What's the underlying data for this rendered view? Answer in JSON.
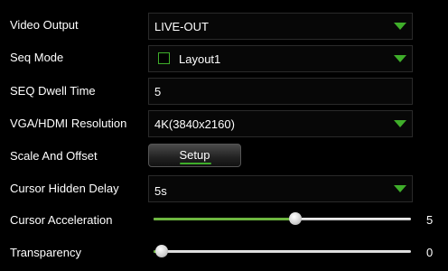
{
  "settings": {
    "video_output": {
      "label": "Video Output",
      "value": "LIVE-OUT"
    },
    "seq_mode": {
      "label": "Seq Mode",
      "value": "Layout1",
      "checked": false
    },
    "seq_dwell_time": {
      "label": "SEQ Dwell Time",
      "value": "5"
    },
    "resolution": {
      "label": "VGA/HDMI Resolution",
      "value": "4K(3840x2160)"
    },
    "scale_offset": {
      "label": "Scale And Offset",
      "button_label": "Setup"
    },
    "cursor_hidden_delay": {
      "label": "Cursor Hidden Delay",
      "value": "5s"
    },
    "cursor_acceleration": {
      "label": "Cursor Acceleration",
      "value": "5",
      "level": 0.55
    },
    "transparency": {
      "label": "Transparency",
      "value": "0",
      "level": 0.03
    }
  },
  "colors": {
    "accent": "#3fae2a",
    "background": "#000000"
  },
  "icons": {
    "dropdown": "chevron-down-icon"
  }
}
